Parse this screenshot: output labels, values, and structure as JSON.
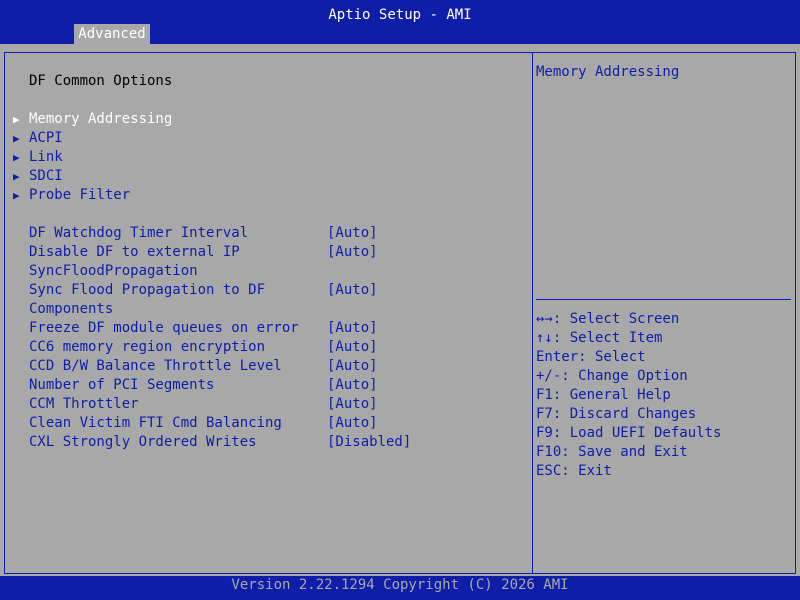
{
  "header": {
    "title": "Aptio Setup - AMI",
    "tab_label": "Advanced"
  },
  "left": {
    "section_title": "DF Common Options",
    "submenus": [
      {
        "label": "Memory Addressing",
        "selected": true
      },
      {
        "label": "ACPI",
        "selected": false
      },
      {
        "label": "Link",
        "selected": false
      },
      {
        "label": "SDCI",
        "selected": false
      },
      {
        "label": "Probe Filter",
        "selected": false
      }
    ],
    "options": [
      {
        "name": "DF Watchdog Timer Interval",
        "value": "[Auto]"
      },
      {
        "name": "Disable DF to external IP\nSyncFloodPropagation",
        "value": "[Auto]"
      },
      {
        "name": "Sync Flood Propagation to DF\nComponents",
        "value": "[Auto]"
      },
      {
        "name": "Freeze DF module queues on error",
        "value": "[Auto]"
      },
      {
        "name": "CC6 memory region encryption",
        "value": "[Auto]"
      },
      {
        "name": "CCD B/W Balance Throttle Level",
        "value": "[Auto]"
      },
      {
        "name": "Number of PCI Segments",
        "value": "[Auto]"
      },
      {
        "name": "CCM Throttler",
        "value": "[Auto]"
      },
      {
        "name": "Clean Victim FTI Cmd Balancing",
        "value": "[Auto]"
      },
      {
        "name": "CXL Strongly Ordered Writes",
        "value": "[Disabled]"
      }
    ]
  },
  "right": {
    "help_title": "Memory Addressing",
    "keys": [
      "↔→: Select Screen",
      "↑↓: Select Item",
      "Enter: Select",
      "+/-: Change Option",
      "F1: General Help",
      "F7: Discard Changes",
      "F9: Load UEFI Defaults",
      "F10: Save and Exit",
      "ESC: Exit"
    ]
  },
  "footer": {
    "version": "Version 2.22.1294 Copyright (C) 2026 AMI"
  },
  "colors": {
    "bios_blue": "#0f1ea8",
    "panel_gray": "#a8a8a8",
    "selected_text": "#ffffff"
  },
  "icons": {
    "submenu_arrow": "triangle-right-icon"
  }
}
